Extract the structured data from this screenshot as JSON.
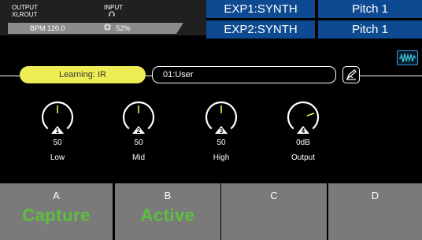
{
  "status": {
    "output_label": "OUTPUT",
    "output_value": "XLROUT",
    "input_label": "INPUT",
    "input_icon": "headphones-icon",
    "bpm": "BPM 120.0",
    "cpu_icon": "cpu-icon",
    "cpu": "52%"
  },
  "exp": [
    {
      "name": "EXP1:SYNTH",
      "param": "Pitch 1"
    },
    {
      "name": "EXP2:SYNTH",
      "param": "Pitch 1"
    }
  ],
  "learning": {
    "label": "Learning: IR"
  },
  "preset": {
    "name": "01:User",
    "edit_icon": "pencil-icon"
  },
  "waveform_icon": "waveform-icon",
  "knobs": [
    {
      "num": "1",
      "value": "50",
      "label": "Low",
      "level": 0.5
    },
    {
      "num": "2",
      "value": "50",
      "label": "Mid",
      "level": 0.5
    },
    {
      "num": "3",
      "value": "50",
      "label": "High",
      "level": 0.5
    },
    {
      "num": "4",
      "value": "0dB",
      "label": "Output",
      "level": 0.75
    }
  ],
  "footswitches": [
    {
      "letter": "A",
      "state": "Capture"
    },
    {
      "letter": "B",
      "state": "Active"
    },
    {
      "letter": "C",
      "state": ""
    },
    {
      "letter": "D",
      "state": ""
    }
  ],
  "colors": {
    "exp_bg": "#0d4a91",
    "learning_bg": "#eeed55",
    "knob_pointer": "#eeed55",
    "active_text": "#5cc13c",
    "footswitch_bg": "#7a7a7a"
  }
}
